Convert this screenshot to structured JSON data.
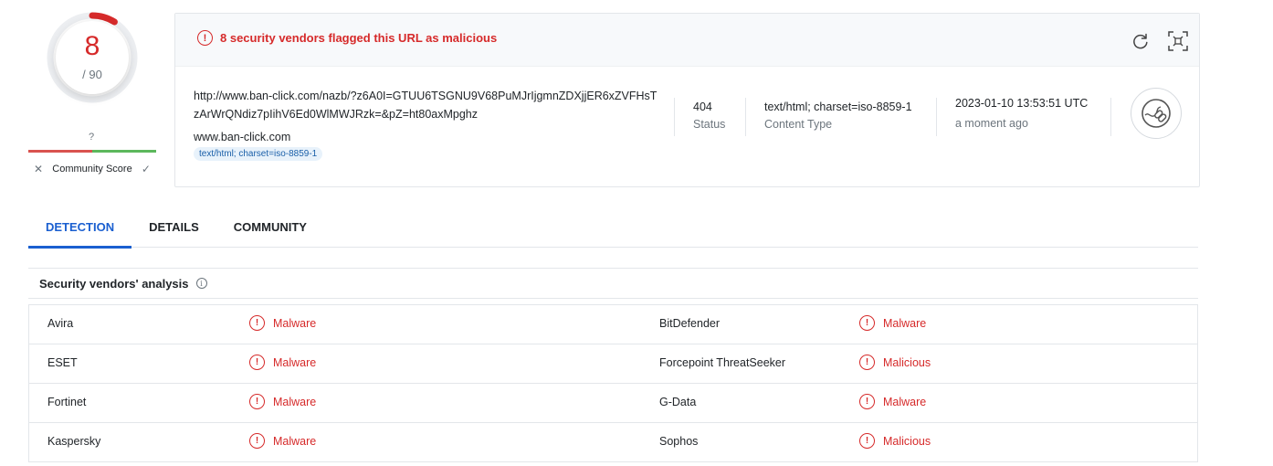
{
  "score": {
    "detections": "8",
    "total": "/ 90",
    "fraction": 0.0889,
    "color": "#d62a2a"
  },
  "community": {
    "value": "?",
    "label": "Community Score"
  },
  "alert": {
    "text": "8 security vendors flagged this URL as malicious"
  },
  "summary": {
    "url": "http://www.ban-click.com/nazb/?z6A0I=GTUU6TSGNU9V68PuMJrIjgmnZDXjjER6xZVFHsTzArWrQNdiz7pIihV6Ed0WlMWJRzk=&pZ=ht80axMpghz",
    "domain": "www.ban-click.com",
    "tag": "text/html; charset=iso-8859-1",
    "status_value": "404",
    "status_label": "Status",
    "content_type_value": "text/html; charset=iso-8859-1",
    "content_type_label": "Content Type",
    "timestamp": "2023-01-10 13:53:51 UTC",
    "relative_time": "a moment ago"
  },
  "tabs": [
    {
      "label": "DETECTION",
      "active": true
    },
    {
      "label": "DETAILS",
      "active": false
    },
    {
      "label": "COMMUNITY",
      "active": false
    }
  ],
  "vendors": {
    "title": "Security vendors' analysis",
    "rows": [
      {
        "left": {
          "name": "Avira",
          "verdict": "Malware"
        },
        "right": {
          "name": "BitDefender",
          "verdict": "Malware"
        }
      },
      {
        "left": {
          "name": "ESET",
          "verdict": "Malware"
        },
        "right": {
          "name": "Forcepoint ThreatSeeker",
          "verdict": "Malicious"
        }
      },
      {
        "left": {
          "name": "Fortinet",
          "verdict": "Malware"
        },
        "right": {
          "name": "G-Data",
          "verdict": "Malware"
        }
      },
      {
        "left": {
          "name": "Kaspersky",
          "verdict": "Malware"
        },
        "right": {
          "name": "Sophos",
          "verdict": "Malicious"
        }
      }
    ]
  },
  "icons": {
    "alert": "alert-circle-icon",
    "reanalyze": "refresh-icon",
    "similar": "similar-search-icon",
    "url": "link-icon",
    "info": "info-icon"
  },
  "colors": {
    "danger": "#d62a2a",
    "accent": "#1a5fd0",
    "tag_bg": "#e8f2fb"
  }
}
